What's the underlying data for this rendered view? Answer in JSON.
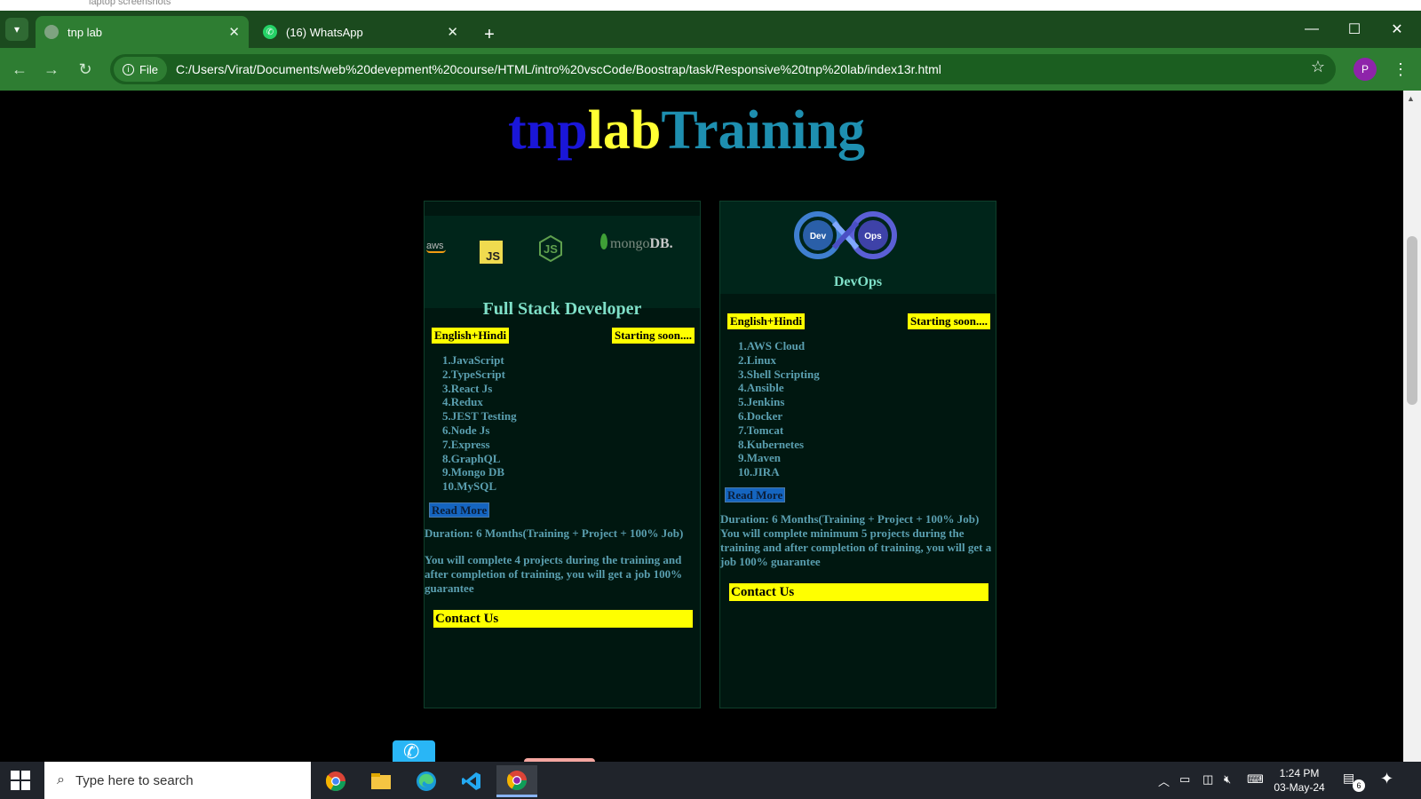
{
  "background_window": {
    "title": "laptop screenshots"
  },
  "tabs": [
    {
      "title": "tnp lab",
      "active": true
    },
    {
      "title": "(16) WhatsApp",
      "active": false
    }
  ],
  "toolbar": {
    "chip_label": "File",
    "url": "C:/Users/Virat/Documents/web%20devepment%20course/HTML/intro%20vscCode/Boostrap/task/Responsive%20tnp%20lab/index13r.html",
    "profile_initial": "P"
  },
  "page": {
    "brand": {
      "part1": "tnp",
      "part2": "lab",
      "part3": "Training"
    },
    "cards": [
      {
        "logos": {
          "aws": "aws",
          "js": "JS",
          "mongo_text": "mongo",
          "mongo_db": "DB."
        },
        "title": "Full Stack Developer",
        "language": "English+Hindi",
        "status": "Starting soon....",
        "topics": [
          "1.JavaScript",
          "2.TypeScript",
          "3.React Js",
          "4.Redux",
          "5.JEST Testing",
          "6.Node Js",
          "7.Express",
          "8.GraphQL",
          "9.Mongo DB",
          "10.MySQL"
        ],
        "read_more": "Read More",
        "duration": "Duration: 6 Months(Training + Project + 100% Job)",
        "description": "You will complete 4 projects during the training and after completion of training, you will get a job 100% guarantee",
        "contact": "Contact Us"
      },
      {
        "logo_labels": {
          "left": "Dev",
          "right": "Ops"
        },
        "title": "DevOps",
        "language": "English+Hindi",
        "status": "Starting soon....",
        "topics": [
          "1.AWS Cloud",
          "2.Linux",
          "3.Shell Scripting",
          "4.Ansible",
          "5.Jenkins",
          "6.Docker",
          "7.Tomcat",
          "8.Kubernetes",
          "9.Maven",
          "10.JIRA"
        ],
        "read_more": "Read More",
        "duration": "Duration: 6 Months(Training + Project + 100% Job)",
        "description": "You will complete minimum 5 projects during the training and after completion of training, you will get a job 100% guarantee",
        "contact": "Contact Us"
      }
    ]
  },
  "taskbar": {
    "search_placeholder": "Type here to search",
    "apps": [
      "chrome-icon",
      "file-explorer-icon",
      "edge-icon",
      "vscode-icon",
      "chrome-profile-icon"
    ],
    "time": "1:24 PM",
    "date": "03-May-24",
    "notification_count": "6"
  },
  "colors": {
    "tab_strip": "#1b4a1e",
    "toolbar": "#2e7d32",
    "brand_tnp": "#1a16d8",
    "brand_lab": "#ffff33",
    "brand_training": "#1e8fb0",
    "badge": "#ffff00",
    "card_bg": "#001710"
  }
}
